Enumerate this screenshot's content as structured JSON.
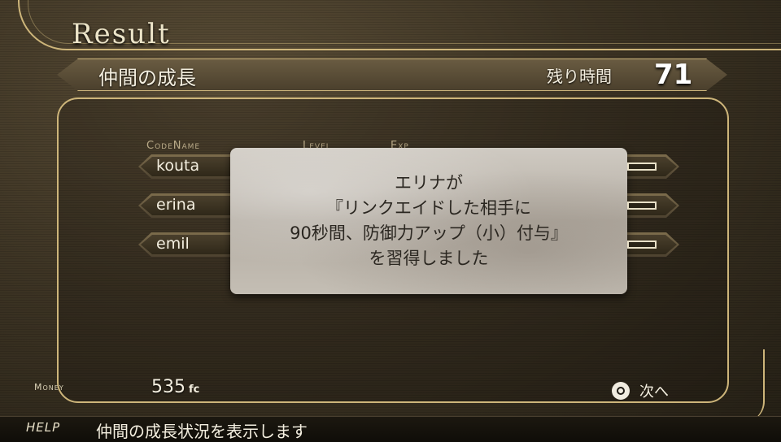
{
  "screen": {
    "title": "Result",
    "header": {
      "section": "仲間の成長",
      "time_label": "残り時間",
      "time_value": "71"
    }
  },
  "table": {
    "columns": {
      "codename": "CodeName",
      "level": "Level",
      "exp": "Exp"
    },
    "members": [
      {
        "name": "kouta"
      },
      {
        "name": "erina"
      },
      {
        "name": "emil"
      }
    ]
  },
  "popup": {
    "lines": [
      "エリナが",
      "『リンクエイドした相手に",
      "90秒間、防御力アップ（小）付与』",
      "を習得しました"
    ]
  },
  "footer": {
    "money_label": "Money",
    "money_value": "535",
    "money_unit": "fc",
    "next_label": "次へ",
    "help_label": "HELP",
    "help_text": "仲間の成長状況を表示します"
  },
  "colors": {
    "gold": "#cdb57a",
    "background": "#3d3424",
    "popup": "#c4beb4"
  },
  "icons": {
    "next": "circle-button-icon"
  }
}
